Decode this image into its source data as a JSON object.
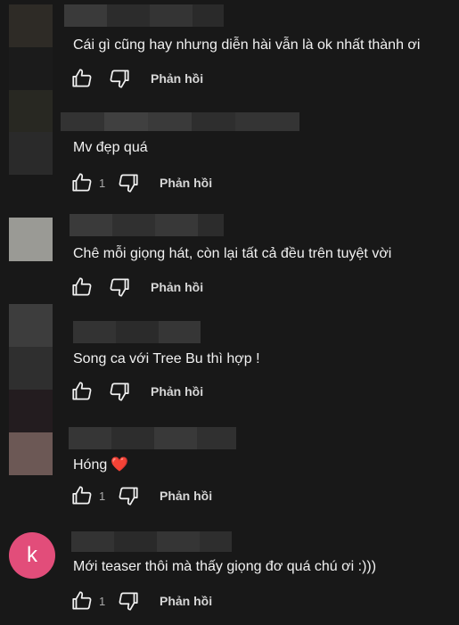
{
  "comments": [
    {
      "text": "Cái gì cũng hay nhưng diễn hài vẫn là ok nhất thành ơi",
      "likes": "",
      "reply_label": "Phản hồi"
    },
    {
      "text": "Mv đẹp quá",
      "likes": "1",
      "reply_label": "Phản hồi"
    },
    {
      "text": "Chê mỗi giọng hát, còn lại tất cả đều trên tuyệt vời",
      "likes": "",
      "reply_label": "Phản hồi"
    },
    {
      "text": "Song ca với Tree Bu thì hợp !",
      "likes": "",
      "reply_label": "Phản hồi"
    },
    {
      "text": "Hóng",
      "emoji": "❤️",
      "likes": "1",
      "reply_label": "Phản hồi"
    },
    {
      "text": "Mới teaser thôi mà thấy giọng đơ quá chú ơi :)))",
      "likes": "1",
      "reply_label": "Phản hồi",
      "avatar_letter": "k"
    }
  ],
  "icons": {
    "like": "thumb-up-icon",
    "dislike": "thumb-down-icon"
  },
  "colors": {
    "background": "#181818",
    "text": "#f1f1f1",
    "secondary": "#aaaaaa",
    "avatar_k": "#e24d7a",
    "heart": "#e84a5f"
  }
}
